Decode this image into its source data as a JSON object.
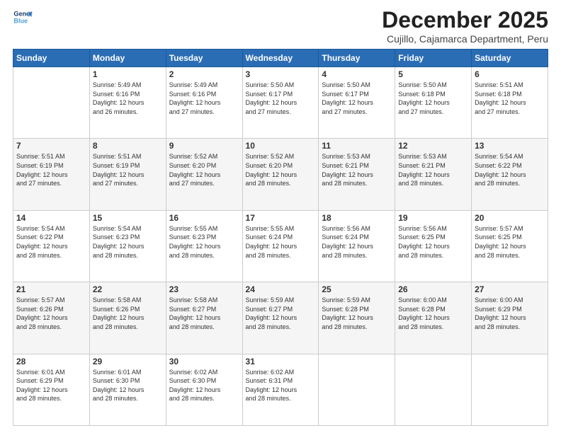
{
  "logo": {
    "line1": "General",
    "line2": "Blue"
  },
  "title": "December 2025",
  "subtitle": "Cujillo, Cajamarca Department, Peru",
  "days_header": [
    "Sunday",
    "Monday",
    "Tuesday",
    "Wednesday",
    "Thursday",
    "Friday",
    "Saturday"
  ],
  "weeks": [
    [
      {
        "day": "",
        "info": ""
      },
      {
        "day": "1",
        "info": "Sunrise: 5:49 AM\nSunset: 6:16 PM\nDaylight: 12 hours\nand 26 minutes."
      },
      {
        "day": "2",
        "info": "Sunrise: 5:49 AM\nSunset: 6:16 PM\nDaylight: 12 hours\nand 27 minutes."
      },
      {
        "day": "3",
        "info": "Sunrise: 5:50 AM\nSunset: 6:17 PM\nDaylight: 12 hours\nand 27 minutes."
      },
      {
        "day": "4",
        "info": "Sunrise: 5:50 AM\nSunset: 6:17 PM\nDaylight: 12 hours\nand 27 minutes."
      },
      {
        "day": "5",
        "info": "Sunrise: 5:50 AM\nSunset: 6:18 PM\nDaylight: 12 hours\nand 27 minutes."
      },
      {
        "day": "6",
        "info": "Sunrise: 5:51 AM\nSunset: 6:18 PM\nDaylight: 12 hours\nand 27 minutes."
      }
    ],
    [
      {
        "day": "7",
        "info": "Sunrise: 5:51 AM\nSunset: 6:19 PM\nDaylight: 12 hours\nand 27 minutes."
      },
      {
        "day": "8",
        "info": "Sunrise: 5:51 AM\nSunset: 6:19 PM\nDaylight: 12 hours\nand 27 minutes."
      },
      {
        "day": "9",
        "info": "Sunrise: 5:52 AM\nSunset: 6:20 PM\nDaylight: 12 hours\nand 27 minutes."
      },
      {
        "day": "10",
        "info": "Sunrise: 5:52 AM\nSunset: 6:20 PM\nDaylight: 12 hours\nand 28 minutes."
      },
      {
        "day": "11",
        "info": "Sunrise: 5:53 AM\nSunset: 6:21 PM\nDaylight: 12 hours\nand 28 minutes."
      },
      {
        "day": "12",
        "info": "Sunrise: 5:53 AM\nSunset: 6:21 PM\nDaylight: 12 hours\nand 28 minutes."
      },
      {
        "day": "13",
        "info": "Sunrise: 5:54 AM\nSunset: 6:22 PM\nDaylight: 12 hours\nand 28 minutes."
      }
    ],
    [
      {
        "day": "14",
        "info": "Sunrise: 5:54 AM\nSunset: 6:22 PM\nDaylight: 12 hours\nand 28 minutes."
      },
      {
        "day": "15",
        "info": "Sunrise: 5:54 AM\nSunset: 6:23 PM\nDaylight: 12 hours\nand 28 minutes."
      },
      {
        "day": "16",
        "info": "Sunrise: 5:55 AM\nSunset: 6:23 PM\nDaylight: 12 hours\nand 28 minutes."
      },
      {
        "day": "17",
        "info": "Sunrise: 5:55 AM\nSunset: 6:24 PM\nDaylight: 12 hours\nand 28 minutes."
      },
      {
        "day": "18",
        "info": "Sunrise: 5:56 AM\nSunset: 6:24 PM\nDaylight: 12 hours\nand 28 minutes."
      },
      {
        "day": "19",
        "info": "Sunrise: 5:56 AM\nSunset: 6:25 PM\nDaylight: 12 hours\nand 28 minutes."
      },
      {
        "day": "20",
        "info": "Sunrise: 5:57 AM\nSunset: 6:25 PM\nDaylight: 12 hours\nand 28 minutes."
      }
    ],
    [
      {
        "day": "21",
        "info": "Sunrise: 5:57 AM\nSunset: 6:26 PM\nDaylight: 12 hours\nand 28 minutes."
      },
      {
        "day": "22",
        "info": "Sunrise: 5:58 AM\nSunset: 6:26 PM\nDaylight: 12 hours\nand 28 minutes."
      },
      {
        "day": "23",
        "info": "Sunrise: 5:58 AM\nSunset: 6:27 PM\nDaylight: 12 hours\nand 28 minutes."
      },
      {
        "day": "24",
        "info": "Sunrise: 5:59 AM\nSunset: 6:27 PM\nDaylight: 12 hours\nand 28 minutes."
      },
      {
        "day": "25",
        "info": "Sunrise: 5:59 AM\nSunset: 6:28 PM\nDaylight: 12 hours\nand 28 minutes."
      },
      {
        "day": "26",
        "info": "Sunrise: 6:00 AM\nSunset: 6:28 PM\nDaylight: 12 hours\nand 28 minutes."
      },
      {
        "day": "27",
        "info": "Sunrise: 6:00 AM\nSunset: 6:29 PM\nDaylight: 12 hours\nand 28 minutes."
      }
    ],
    [
      {
        "day": "28",
        "info": "Sunrise: 6:01 AM\nSunset: 6:29 PM\nDaylight: 12 hours\nand 28 minutes."
      },
      {
        "day": "29",
        "info": "Sunrise: 6:01 AM\nSunset: 6:30 PM\nDaylight: 12 hours\nand 28 minutes."
      },
      {
        "day": "30",
        "info": "Sunrise: 6:02 AM\nSunset: 6:30 PM\nDaylight: 12 hours\nand 28 minutes."
      },
      {
        "day": "31",
        "info": "Sunrise: 6:02 AM\nSunset: 6:31 PM\nDaylight: 12 hours\nand 28 minutes."
      },
      {
        "day": "",
        "info": ""
      },
      {
        "day": "",
        "info": ""
      },
      {
        "day": "",
        "info": ""
      }
    ]
  ]
}
